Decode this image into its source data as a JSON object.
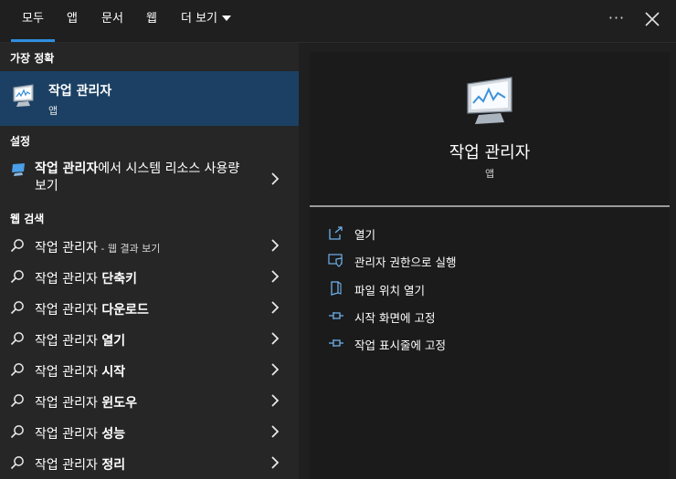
{
  "tabs": [
    {
      "label": "모두",
      "active": true
    },
    {
      "label": "앱",
      "active": false
    },
    {
      "label": "문서",
      "active": false
    },
    {
      "label": "웹",
      "active": false
    },
    {
      "label": "더 보기",
      "active": false
    }
  ],
  "window": {
    "more_icon": "more-dots-icon",
    "more_label": "···",
    "close_icon": "close-icon"
  },
  "left": {
    "best_match_header": "가장 정확",
    "best_match": {
      "title": "작업 관리자",
      "subtitle": "앱",
      "icon": "task-manager-icon"
    },
    "settings_header": "설정",
    "settings_item": {
      "bold": "작업 관리자",
      "rest": "에서 시스템 리소스 사용량 보기",
      "icon": "settings-monitor-icon"
    },
    "web_header": "웹 검색",
    "web_items": [
      {
        "prefix": "작업 관리자",
        "suffix": " - 웹 결과 보기",
        "bold": ""
      },
      {
        "prefix": "작업 관리자 ",
        "suffix": "",
        "bold": "단축키"
      },
      {
        "prefix": "작업 관리자 ",
        "suffix": "",
        "bold": "다운로드"
      },
      {
        "prefix": "작업 관리자 ",
        "suffix": "",
        "bold": "열기"
      },
      {
        "prefix": "작업 관리자 ",
        "suffix": "",
        "bold": "시작"
      },
      {
        "prefix": "작업 관리자 ",
        "suffix": "",
        "bold": "윈도우"
      },
      {
        "prefix": "작업 관리자 ",
        "suffix": "",
        "bold": "성능"
      },
      {
        "prefix": "작업 관리자 ",
        "suffix": "",
        "bold": "정리"
      }
    ]
  },
  "right": {
    "title": "작업 관리자",
    "subtitle": "앱",
    "actions": [
      {
        "label": "열기",
        "icon": "open-icon"
      },
      {
        "label": "관리자 권한으로 실행",
        "icon": "shield-admin-icon"
      },
      {
        "label": "파일 위치 열기",
        "icon": "file-location-icon"
      },
      {
        "label": "시작 화면에 고정",
        "icon": "pin-start-icon"
      },
      {
        "label": "작업 표시줄에 고정",
        "icon": "pin-taskbar-icon"
      }
    ]
  },
  "colors": {
    "accent": "#2f8fe0",
    "selected": "#1b4064",
    "icon_blue": "#6fb1ec"
  }
}
